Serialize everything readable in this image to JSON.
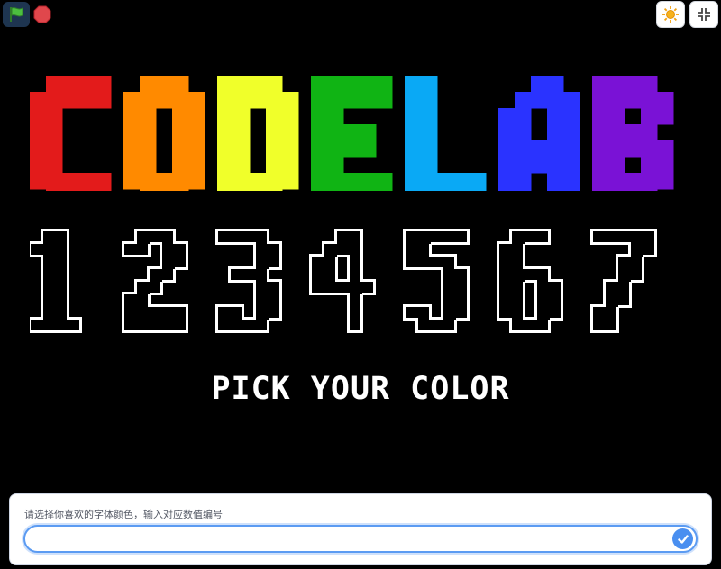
{
  "toolbar": {
    "green_flag_icon": "green-flag-icon",
    "stop_icon": "stop-icon",
    "theme_icon": "sun-icon",
    "unfullscreen_icon": "shrink-icon"
  },
  "stage": {
    "title_letters": [
      {
        "char": "C",
        "color": "#e31b1b"
      },
      {
        "char": "O",
        "color": "#ff8a00"
      },
      {
        "char": "D",
        "color": "#f0ff2a"
      },
      {
        "char": "E",
        "color": "#10b414"
      },
      {
        "char": "L",
        "color": "#0aa9f5"
      },
      {
        "char": "A",
        "color": "#2a33ff"
      },
      {
        "char": "B",
        "color": "#7a12d6"
      }
    ],
    "digits": [
      "1",
      "2",
      "3",
      "4",
      "5",
      "6",
      "7"
    ],
    "pick_text": "PICK YOUR COLOR"
  },
  "ask": {
    "prompt": "请选择你喜欢的字体颜色，输入对应数值编号",
    "answer_value": ""
  }
}
